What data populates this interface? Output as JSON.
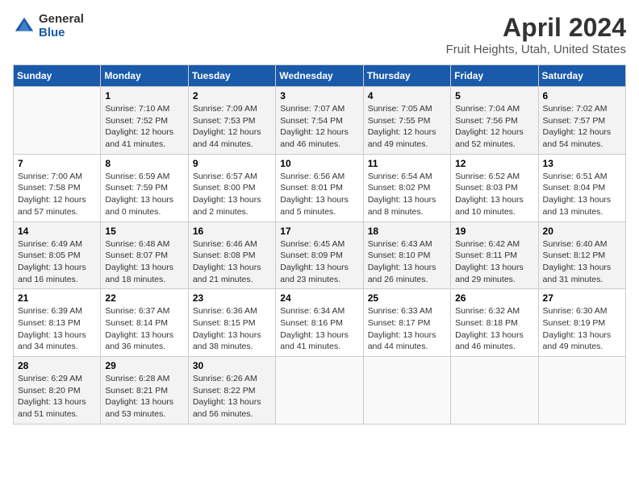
{
  "logo": {
    "general": "General",
    "blue": "Blue"
  },
  "header": {
    "month": "April 2024",
    "location": "Fruit Heights, Utah, United States"
  },
  "weekdays": [
    "Sunday",
    "Monday",
    "Tuesday",
    "Wednesday",
    "Thursday",
    "Friday",
    "Saturday"
  ],
  "weeks": [
    [
      {
        "day": "",
        "info": ""
      },
      {
        "day": "1",
        "info": "Sunrise: 7:10 AM\nSunset: 7:52 PM\nDaylight: 12 hours\nand 41 minutes."
      },
      {
        "day": "2",
        "info": "Sunrise: 7:09 AM\nSunset: 7:53 PM\nDaylight: 12 hours\nand 44 minutes."
      },
      {
        "day": "3",
        "info": "Sunrise: 7:07 AM\nSunset: 7:54 PM\nDaylight: 12 hours\nand 46 minutes."
      },
      {
        "day": "4",
        "info": "Sunrise: 7:05 AM\nSunset: 7:55 PM\nDaylight: 12 hours\nand 49 minutes."
      },
      {
        "day": "5",
        "info": "Sunrise: 7:04 AM\nSunset: 7:56 PM\nDaylight: 12 hours\nand 52 minutes."
      },
      {
        "day": "6",
        "info": "Sunrise: 7:02 AM\nSunset: 7:57 PM\nDaylight: 12 hours\nand 54 minutes."
      }
    ],
    [
      {
        "day": "7",
        "info": "Sunrise: 7:00 AM\nSunset: 7:58 PM\nDaylight: 12 hours\nand 57 minutes."
      },
      {
        "day": "8",
        "info": "Sunrise: 6:59 AM\nSunset: 7:59 PM\nDaylight: 13 hours\nand 0 minutes."
      },
      {
        "day": "9",
        "info": "Sunrise: 6:57 AM\nSunset: 8:00 PM\nDaylight: 13 hours\nand 2 minutes."
      },
      {
        "day": "10",
        "info": "Sunrise: 6:56 AM\nSunset: 8:01 PM\nDaylight: 13 hours\nand 5 minutes."
      },
      {
        "day": "11",
        "info": "Sunrise: 6:54 AM\nSunset: 8:02 PM\nDaylight: 13 hours\nand 8 minutes."
      },
      {
        "day": "12",
        "info": "Sunrise: 6:52 AM\nSunset: 8:03 PM\nDaylight: 13 hours\nand 10 minutes."
      },
      {
        "day": "13",
        "info": "Sunrise: 6:51 AM\nSunset: 8:04 PM\nDaylight: 13 hours\nand 13 minutes."
      }
    ],
    [
      {
        "day": "14",
        "info": "Sunrise: 6:49 AM\nSunset: 8:05 PM\nDaylight: 13 hours\nand 16 minutes."
      },
      {
        "day": "15",
        "info": "Sunrise: 6:48 AM\nSunset: 8:07 PM\nDaylight: 13 hours\nand 18 minutes."
      },
      {
        "day": "16",
        "info": "Sunrise: 6:46 AM\nSunset: 8:08 PM\nDaylight: 13 hours\nand 21 minutes."
      },
      {
        "day": "17",
        "info": "Sunrise: 6:45 AM\nSunset: 8:09 PM\nDaylight: 13 hours\nand 23 minutes."
      },
      {
        "day": "18",
        "info": "Sunrise: 6:43 AM\nSunset: 8:10 PM\nDaylight: 13 hours\nand 26 minutes."
      },
      {
        "day": "19",
        "info": "Sunrise: 6:42 AM\nSunset: 8:11 PM\nDaylight: 13 hours\nand 29 minutes."
      },
      {
        "day": "20",
        "info": "Sunrise: 6:40 AM\nSunset: 8:12 PM\nDaylight: 13 hours\nand 31 minutes."
      }
    ],
    [
      {
        "day": "21",
        "info": "Sunrise: 6:39 AM\nSunset: 8:13 PM\nDaylight: 13 hours\nand 34 minutes."
      },
      {
        "day": "22",
        "info": "Sunrise: 6:37 AM\nSunset: 8:14 PM\nDaylight: 13 hours\nand 36 minutes."
      },
      {
        "day": "23",
        "info": "Sunrise: 6:36 AM\nSunset: 8:15 PM\nDaylight: 13 hours\nand 38 minutes."
      },
      {
        "day": "24",
        "info": "Sunrise: 6:34 AM\nSunset: 8:16 PM\nDaylight: 13 hours\nand 41 minutes."
      },
      {
        "day": "25",
        "info": "Sunrise: 6:33 AM\nSunset: 8:17 PM\nDaylight: 13 hours\nand 44 minutes."
      },
      {
        "day": "26",
        "info": "Sunrise: 6:32 AM\nSunset: 8:18 PM\nDaylight: 13 hours\nand 46 minutes."
      },
      {
        "day": "27",
        "info": "Sunrise: 6:30 AM\nSunset: 8:19 PM\nDaylight: 13 hours\nand 49 minutes."
      }
    ],
    [
      {
        "day": "28",
        "info": "Sunrise: 6:29 AM\nSunset: 8:20 PM\nDaylight: 13 hours\nand 51 minutes."
      },
      {
        "day": "29",
        "info": "Sunrise: 6:28 AM\nSunset: 8:21 PM\nDaylight: 13 hours\nand 53 minutes."
      },
      {
        "day": "30",
        "info": "Sunrise: 6:26 AM\nSunset: 8:22 PM\nDaylight: 13 hours\nand 56 minutes."
      },
      {
        "day": "",
        "info": ""
      },
      {
        "day": "",
        "info": ""
      },
      {
        "day": "",
        "info": ""
      },
      {
        "day": "",
        "info": ""
      }
    ]
  ]
}
